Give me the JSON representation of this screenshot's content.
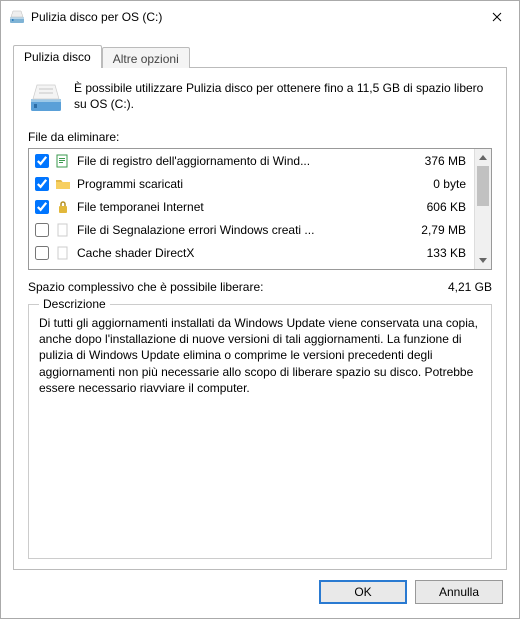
{
  "window": {
    "title": "Pulizia disco per OS (C:)"
  },
  "tabs": {
    "cleanup": "Pulizia disco",
    "options": "Altre opzioni"
  },
  "info": "È possibile utilizzare Pulizia disco per ottenere fino a 11,5 GB di spazio libero su OS (C:).",
  "filesLabel": "File da eliminare:",
  "files": [
    {
      "checked": true,
      "icon": "log",
      "name": "File di registro dell'aggiornamento di Wind...",
      "size": "376 MB"
    },
    {
      "checked": true,
      "icon": "folder",
      "name": "Programmi scaricati",
      "size": "0 byte"
    },
    {
      "checked": true,
      "icon": "lock",
      "name": "File temporanei Internet",
      "size": "606 KB"
    },
    {
      "checked": false,
      "icon": "blank",
      "name": "File di Segnalazione errori Windows creati ...",
      "size": "2,79 MB"
    },
    {
      "checked": false,
      "icon": "blank",
      "name": "Cache shader DirectX",
      "size": "133 KB"
    }
  ],
  "total": {
    "label": "Spazio complessivo che è possibile liberare:",
    "value": "4,21 GB"
  },
  "description": {
    "legend": "Descrizione",
    "text": "Di tutti gli aggiornamenti installati da Windows Update viene conservata una copia, anche dopo l'installazione di nuove versioni di tali aggiornamenti. La funzione di pulizia di Windows Update elimina o comprime le versioni precedenti degli aggiornamenti non più necessarie allo scopo di liberare spazio su disco. Potrebbe essere necessario riavviare il computer."
  },
  "buttons": {
    "ok": "OK",
    "cancel": "Annulla"
  }
}
